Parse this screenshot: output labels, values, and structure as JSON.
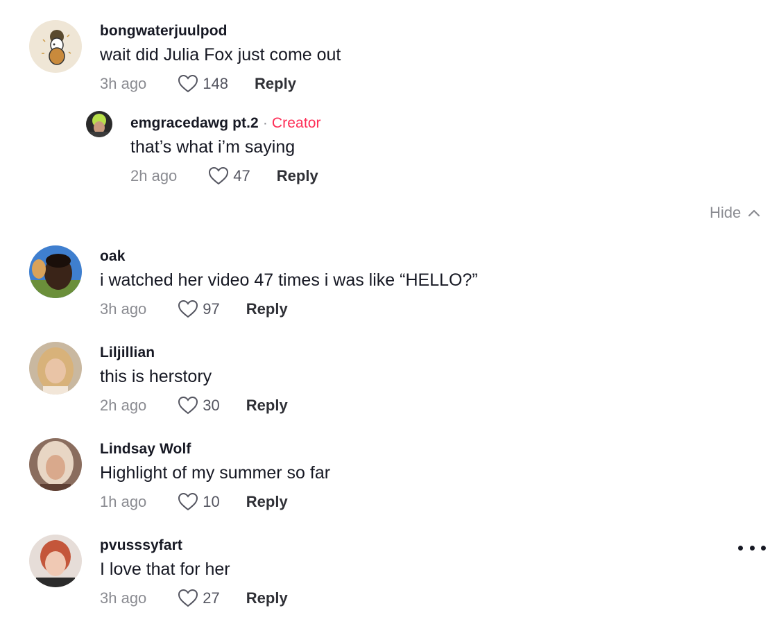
{
  "comments": [
    {
      "username": "bongwaterjuulpod",
      "text": "wait did Julia Fox just come out",
      "time": "3h ago",
      "likes": "148",
      "reply": "Reply"
    },
    {
      "username": "emgracedawg pt.2",
      "separator": "·",
      "badge": "Creator",
      "text": "that’s what i’m saying",
      "time": "2h ago",
      "likes": "47",
      "reply": "Reply"
    },
    {
      "username": "oak",
      "text": "i watched her video 47 times i was like “HELLO?”",
      "time": "3h ago",
      "likes": "97",
      "reply": "Reply"
    },
    {
      "username": "Liljillian",
      "text": "this is herstory",
      "time": "2h ago",
      "likes": "30",
      "reply": "Reply"
    },
    {
      "username": "Lindsay Wolf",
      "text": "Highlight of my summer so far",
      "time": "1h ago",
      "likes": "10",
      "reply": "Reply"
    },
    {
      "username": "pvusssyfart",
      "text": "I love that for her",
      "time": "3h ago",
      "likes": "27",
      "reply": "Reply"
    }
  ],
  "hide_label": "Hide",
  "colors": {
    "creator": "#fe2c55",
    "muted": "#8a8b91",
    "text": "#161823"
  }
}
